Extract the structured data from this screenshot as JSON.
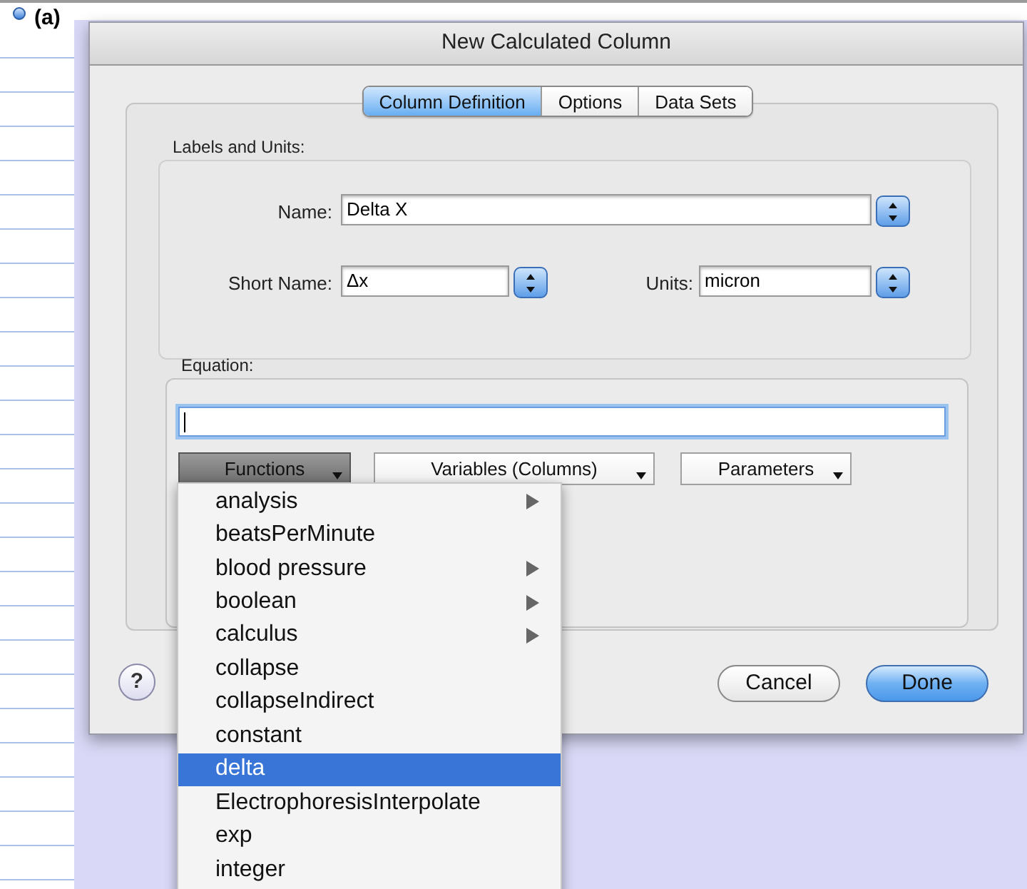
{
  "figure_label": "(a)",
  "window": {
    "title": "New Calculated Column"
  },
  "tabs": [
    {
      "label": "Column Definition",
      "selected": true
    },
    {
      "label": "Options",
      "selected": false
    },
    {
      "label": "Data Sets",
      "selected": false
    }
  ],
  "labels_and_units": {
    "title": "Labels and Units:",
    "name": {
      "label": "Name:",
      "value": "Delta X"
    },
    "short_name": {
      "label": "Short Name:",
      "value": "Δx"
    },
    "units": {
      "label": "Units:",
      "value": "micron"
    }
  },
  "equation": {
    "label": "Equation:",
    "focused": true
  },
  "popup_buttons": [
    {
      "label": "Functions",
      "pressed": true
    },
    {
      "label": "Variables (Columns)",
      "pressed": false
    },
    {
      "label": "Parameters",
      "pressed": false
    }
  ],
  "menu": [
    {
      "label": "analysis",
      "submenu": true,
      "selected": false
    },
    {
      "label": "beatsPerMinute",
      "submenu": false,
      "selected": false
    },
    {
      "label": "blood pressure",
      "submenu": true,
      "selected": false
    },
    {
      "label": "boolean",
      "submenu": true,
      "selected": false
    },
    {
      "label": "calculus",
      "submenu": true,
      "selected": false
    },
    {
      "label": "collapse",
      "submenu": false,
      "selected": false
    },
    {
      "label": "collapseIndirect",
      "submenu": false,
      "selected": false
    },
    {
      "label": "constant",
      "submenu": false,
      "selected": false
    },
    {
      "label": "delta",
      "submenu": false,
      "selected": true
    },
    {
      "label": "ElectrophoresisInterpolate",
      "submenu": false,
      "selected": false
    },
    {
      "label": "exp",
      "submenu": false,
      "selected": false
    },
    {
      "label": "integer",
      "submenu": false,
      "selected": false
    }
  ],
  "help_button": {
    "label": "?"
  },
  "buttons": [
    {
      "label": "Cancel",
      "default": false
    },
    {
      "label": "Done",
      "default": true
    }
  ]
}
